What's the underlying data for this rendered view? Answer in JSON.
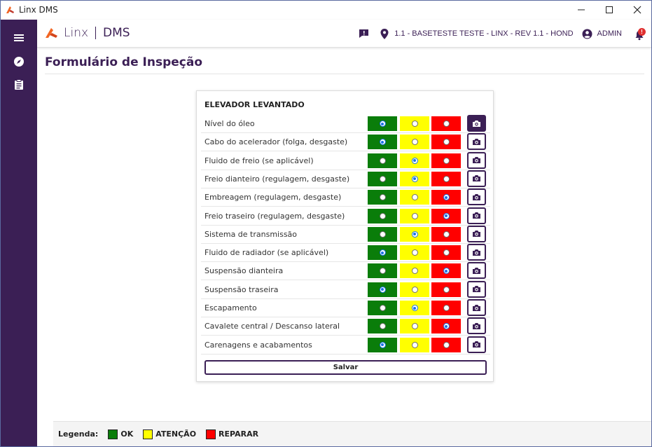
{
  "window": {
    "title": "Linx DMS"
  },
  "header": {
    "brand": "Linx",
    "product": "DMS",
    "location": "1.1 - BASETESTE TESTE - LINX - REV 1.1 - HOND",
    "user": "ADMIN",
    "notification_badge": "!"
  },
  "page": {
    "title": "Formulário de Inspeção"
  },
  "form": {
    "section_title": "ELEVADOR LEVANTADO",
    "items": [
      {
        "label": "Nível do óleo",
        "status": "ok",
        "photo": true
      },
      {
        "label": "Cabo do acelerador (folga, desgaste)",
        "status": "ok",
        "photo": false
      },
      {
        "label": "Fluido de freio (se aplicável)",
        "status": "atencao",
        "photo": false
      },
      {
        "label": "Freio dianteiro (regulagem, desgaste)",
        "status": "atencao",
        "photo": false
      },
      {
        "label": "Embreagem (regulagem, desgaste)",
        "status": "reparar",
        "photo": false
      },
      {
        "label": "Freio traseiro (regulagem, desgaste)",
        "status": "reparar",
        "photo": false
      },
      {
        "label": "Sistema de transmissão",
        "status": "atencao",
        "photo": false
      },
      {
        "label": "Fluido de radiador (se aplicável)",
        "status": "ok",
        "photo": false
      },
      {
        "label": "Suspensão dianteira",
        "status": "reparar",
        "photo": false
      },
      {
        "label": "Suspensão traseira",
        "status": "ok",
        "photo": false
      },
      {
        "label": "Escapamento",
        "status": "atencao",
        "photo": false
      },
      {
        "label": "Cavalete central / Descanso lateral",
        "status": "reparar",
        "photo": false
      },
      {
        "label": "Carenagens e acabamentos",
        "status": "ok",
        "photo": false
      }
    ],
    "save_label": "Salvar"
  },
  "legend": {
    "title": "Legenda:",
    "items": [
      {
        "label": "OK",
        "color": "#0a7d0a"
      },
      {
        "label": "ATENÇÃO",
        "color": "#ffff00"
      },
      {
        "label": "REPARAR",
        "color": "#ff0000"
      }
    ]
  },
  "colors": {
    "brand": "#3b1f55",
    "ok": "#0a7d0a",
    "attention": "#ffff00",
    "repair": "#ff0000",
    "accent": "#f26522"
  }
}
